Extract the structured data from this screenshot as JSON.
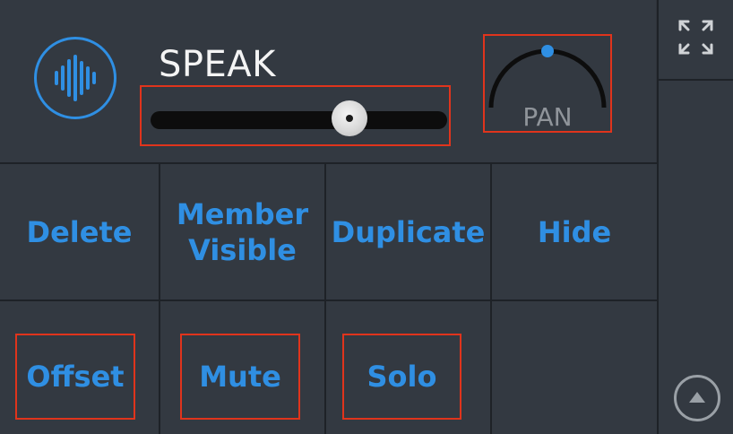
{
  "track": {
    "name": "SPEAK",
    "volume_fraction": 0.67
  },
  "pan": {
    "label": "PAN",
    "position_fraction": 0.5
  },
  "buttons": {
    "delete": "Delete",
    "member_visible": "Member\nVisible",
    "duplicate": "Duplicate",
    "hide": "Hide",
    "offset": "Offset",
    "mute": "Mute",
    "solo": "Solo"
  },
  "icons": {
    "track": "waveform-icon",
    "expand": "expand-icon",
    "up": "up-arrow-circle-icon"
  },
  "colors": {
    "background": "#2f343b",
    "accent": "#2f8fe3",
    "highlight": "#e0341c",
    "text": "#f4f4f4",
    "muted": "#8f949a"
  }
}
